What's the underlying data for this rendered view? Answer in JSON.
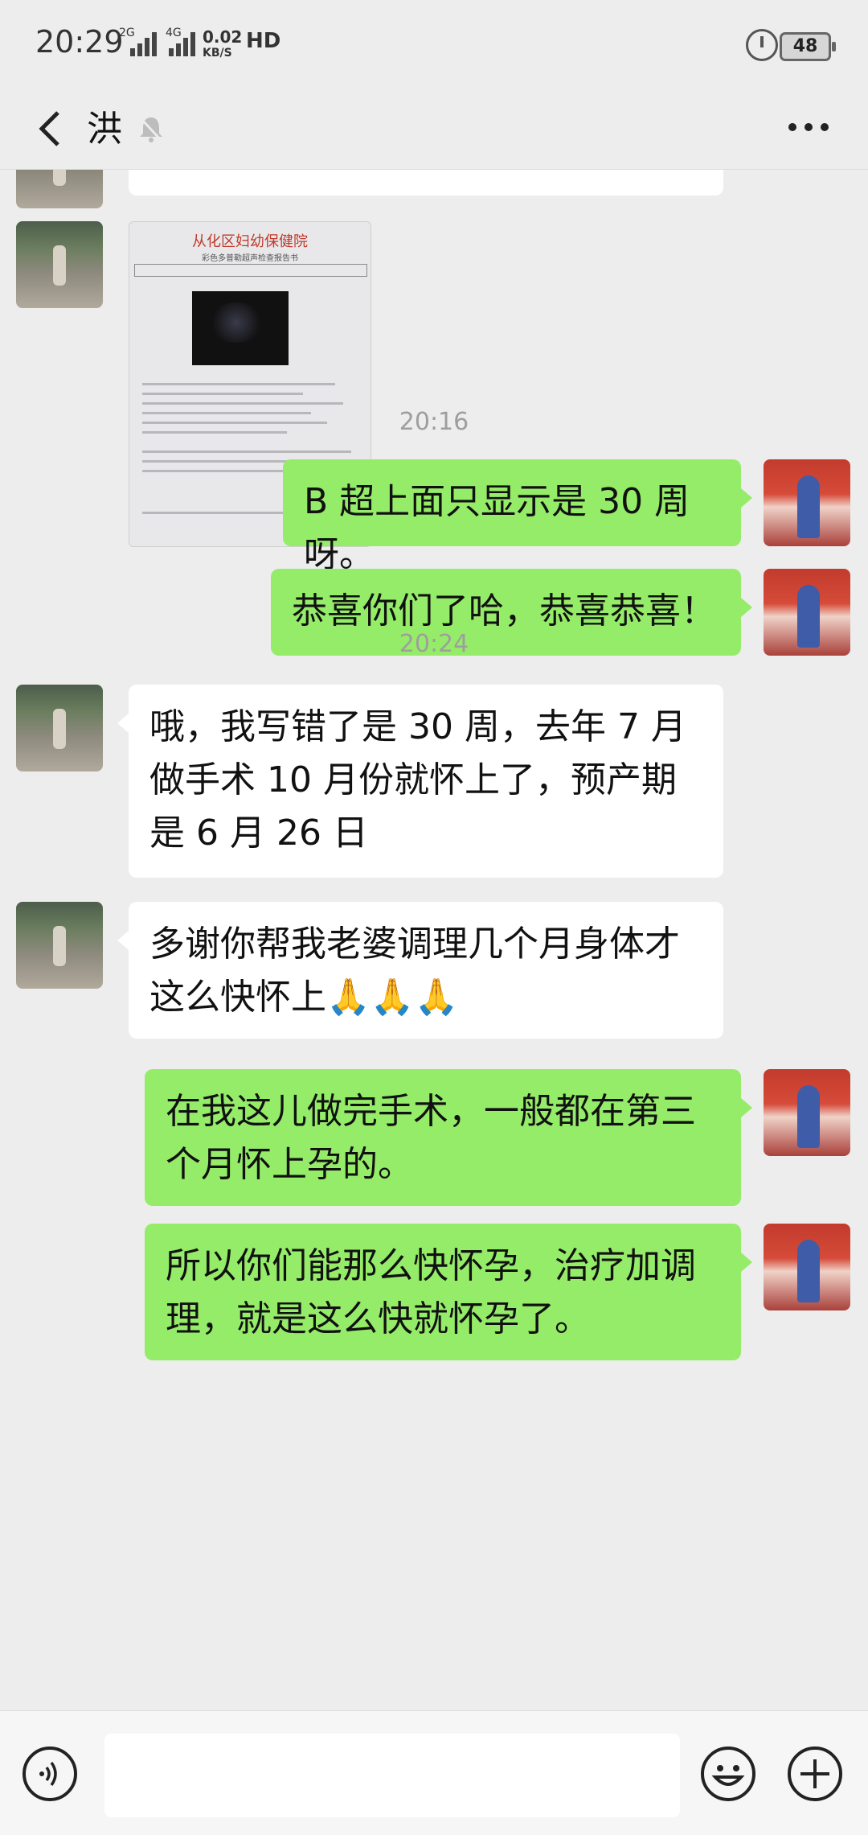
{
  "status_bar": {
    "time": "20:29",
    "net1": "2G",
    "net2": "4G",
    "speed_value": "0.02",
    "speed_unit": "KB/S",
    "hd": "HD",
    "battery": "48"
  },
  "header": {
    "title": "洪"
  },
  "report_image": {
    "title": "从化区妇幼保健院",
    "subtitle": "彩色多普勒超声检查报告书"
  },
  "messages": [
    {
      "type": "timestamp",
      "text": "20:16"
    },
    {
      "type": "outgoing",
      "text": "B 超上面只显示是 30 周呀。"
    },
    {
      "type": "outgoing",
      "text": "恭喜你们了哈，恭喜恭喜！"
    },
    {
      "type": "timestamp",
      "text": "20:24"
    },
    {
      "type": "incoming",
      "text": "哦，我写错了是 30 周，去年 7 月做手术 10 月份就怀上了，预产期是 6 月 26 日"
    },
    {
      "type": "incoming",
      "text": "多谢你帮我老婆调理几个月身体才这么快怀上🙏🙏🙏"
    },
    {
      "type": "outgoing",
      "text": "在我这儿做完手术，一般都在第三个月怀上孕的。"
    },
    {
      "type": "outgoing",
      "text": "所以你们能那么快怀孕，治疗加调理，就是这么快就怀孕了。"
    }
  ],
  "icons": {
    "back": "back-arrow-icon",
    "mute": "bell-mute-icon",
    "more": "more-dots-icon",
    "voice": "voice-icon",
    "emoji": "emoji-icon",
    "add": "plus-icon"
  },
  "colors": {
    "outgoing_bubble": "#95ec69",
    "incoming_bubble": "#ffffff",
    "background": "#ededed"
  }
}
